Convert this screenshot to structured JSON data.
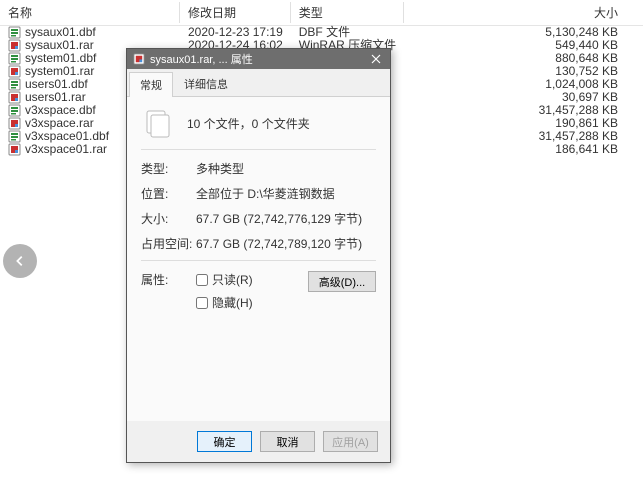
{
  "columns": {
    "name": "名称",
    "modified": "修改日期",
    "type": "类型",
    "size": "大小"
  },
  "files": [
    {
      "name": "sysaux01.dbf",
      "modified": "2020-12-23 17:19",
      "type": "DBF 文件",
      "size": "5,130,248 KB",
      "kind": "dbf"
    },
    {
      "name": "sysaux01.rar",
      "modified": "2020-12-24 16:02",
      "type": "WinRAR 压缩文件",
      "size": "549,440 KB",
      "kind": "rar"
    },
    {
      "name": "system01.dbf",
      "modified": "",
      "type": "",
      "size": "880,648 KB",
      "kind": "dbf"
    },
    {
      "name": "system01.rar",
      "modified": "",
      "type": "",
      "size": "130,752 KB",
      "kind": "rar"
    },
    {
      "name": "users01.dbf",
      "modified": "",
      "type": "",
      "size": "1,024,008 KB",
      "kind": "dbf"
    },
    {
      "name": "users01.rar",
      "modified": "",
      "type": "",
      "size": "30,697 KB",
      "kind": "rar"
    },
    {
      "name": "v3xspace.dbf",
      "modified": "",
      "type": "",
      "size": "31,457,288 KB",
      "kind": "dbf"
    },
    {
      "name": "v3xspace.rar",
      "modified": "",
      "type": "",
      "size": "190,861 KB",
      "kind": "rar"
    },
    {
      "name": "v3xspace01.dbf",
      "modified": "",
      "type": "",
      "size": "31,457,288 KB",
      "kind": "dbf"
    },
    {
      "name": "v3xspace01.rar",
      "modified": "",
      "type": "",
      "size": "186,641 KB",
      "kind": "rar"
    }
  ],
  "dialog": {
    "title": "sysaux01.rar, ... 属性",
    "tabs": {
      "general": "常规",
      "details": "详细信息"
    },
    "summary": "10 个文件，0 个文件夹",
    "props": {
      "type_label": "类型:",
      "type_value": "多种类型",
      "location_label": "位置:",
      "location_value": "全部位于 D:\\华菱涟钢数据",
      "size_label": "大小:",
      "size_value": "67.7 GB (72,742,776,129 字节)",
      "disk_label": "占用空间:",
      "disk_value": "67.7 GB (72,742,789,120 字节)",
      "attr_label": "属性:",
      "readonly": "只读(R)",
      "hidden": "隐藏(H)",
      "advanced": "高级(D)..."
    },
    "actions": {
      "ok": "确定",
      "cancel": "取消",
      "apply": "应用(A)"
    }
  }
}
